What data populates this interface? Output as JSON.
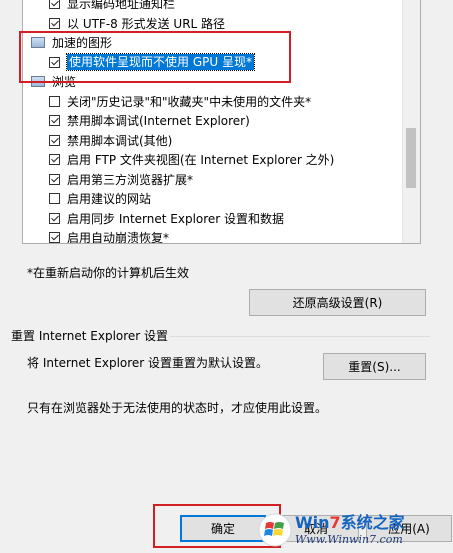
{
  "tree": {
    "items": [
      {
        "kind": "check",
        "checked": true,
        "label": "显示编码地址通知栏"
      },
      {
        "kind": "check",
        "checked": true,
        "label": "以 UTF-8 形式发送 URL 路径"
      },
      {
        "kind": "group",
        "label": "加速的图形"
      },
      {
        "kind": "check",
        "checked": true,
        "label": "使用软件呈现而不使用 GPU 呈现*",
        "selected": true
      },
      {
        "kind": "group",
        "label": "浏览"
      },
      {
        "kind": "check",
        "checked": false,
        "label": "关闭\"历史记录\"和\"收藏夹\"中未使用的文件夹*"
      },
      {
        "kind": "check",
        "checked": true,
        "label": "禁用脚本调试(Internet Explorer)"
      },
      {
        "kind": "check",
        "checked": true,
        "label": "禁用脚本调试(其他)"
      },
      {
        "kind": "check",
        "checked": true,
        "label": "启用 FTP 文件夹视图(在 Internet Explorer 之外)"
      },
      {
        "kind": "check",
        "checked": true,
        "label": "启用第三方浏览器扩展*"
      },
      {
        "kind": "check",
        "checked": false,
        "label": "启用建议的网站"
      },
      {
        "kind": "check",
        "checked": true,
        "label": "启用同步 Internet Explorer 设置和数据"
      },
      {
        "kind": "check",
        "checked": true,
        "label": "启用自动崩溃恢复*"
      }
    ]
  },
  "restart_note": "*在重新启动你的计算机后生效",
  "restore_advanced_button": "还原高级设置(R)",
  "reset_section": {
    "title": "重置 Internet Explorer 设置",
    "description": "将 Internet Explorer 设置重置为默认设置。",
    "reset_button": "重置(S)...",
    "note": "只有在浏览器处于无法使用的状态时，才应使用此设置。"
  },
  "footer": {
    "ok_button": "确定",
    "cancel_button": "取消",
    "apply_button": "应用(A)"
  },
  "watermark": {
    "title_blue": "Win",
    "title_red": "7",
    "title_rest": "系统之家",
    "url": "Www.Winwin7.com"
  }
}
